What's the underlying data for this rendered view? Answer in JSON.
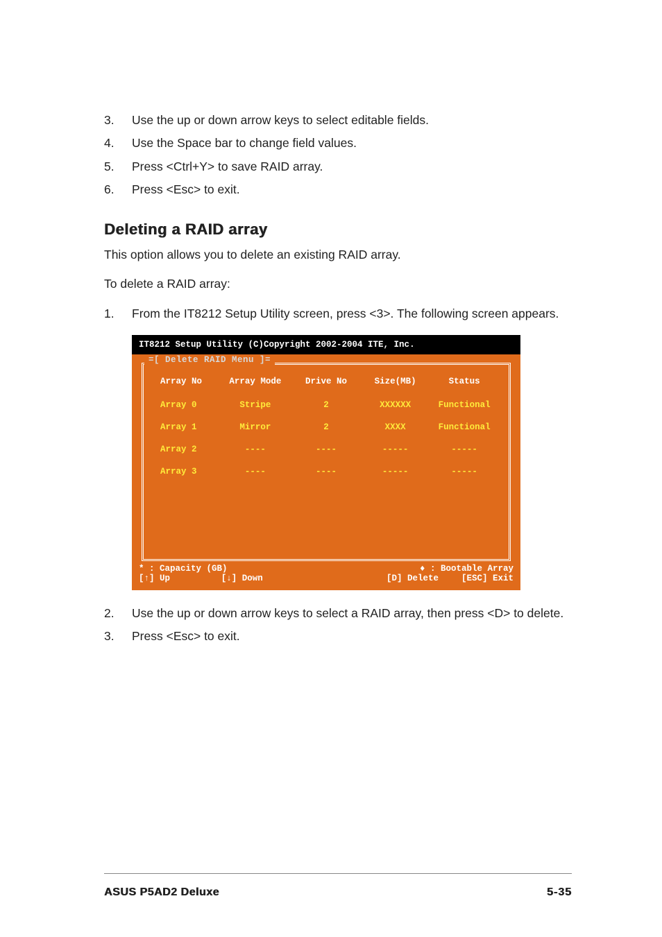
{
  "top_steps": [
    {
      "num": "3.",
      "text": "Use the up or down arrow keys to select editable fields."
    },
    {
      "num": "4.",
      "text": "Use the Space bar to change field values."
    },
    {
      "num": "5.",
      "text": "Press <Ctrl+Y> to save RAID array."
    },
    {
      "num": "6.",
      "text": "Press <Esc> to exit."
    }
  ],
  "section_heading": "Deleting a RAID array",
  "intro_para": "This option allows you to delete an existing RAID array.",
  "lead_para": "To delete a RAID array:",
  "step1": {
    "num": "1.",
    "text": "From the IT8212 Setup Utility screen, press <3>. The following screen appears."
  },
  "screenshot": {
    "title": "IT8212 Setup Utility (C)Copyright 2002-2004 ITE, Inc.",
    "menu_title": "=[ Delete RAID Menu ]=",
    "headers": {
      "c1": "Array No",
      "c2": "Array Mode",
      "c3": "Drive No",
      "c4": "Size(MB)",
      "c5": "Status"
    },
    "rows": [
      {
        "c1": "Array 0",
        "c2": "Stripe",
        "c3": "2",
        "c4": "XXXXXX",
        "c5": "Functional"
      },
      {
        "c1": "Array 1",
        "c2": "Mirror",
        "c3": "2",
        "c4": "XXXX",
        "c5": "Functional"
      },
      {
        "c1": "Array 2",
        "c2": "----",
        "c3": "----",
        "c4": "-----",
        "c5": "-----"
      },
      {
        "c1": "Array 3",
        "c2": "----",
        "c3": "----",
        "c4": "-----",
        "c5": "-----"
      }
    ],
    "footer_line1_left": "* : Capacity (GB)",
    "footer_line1_right": "♦ : Bootable Array",
    "footer_line2_1": "[↑] Up",
    "footer_line2_2": "[↓] Down",
    "footer_line2_3": "[D] Delete",
    "footer_line2_4": "[ESC] Exit"
  },
  "after_steps": [
    {
      "num": "2.",
      "text": "Use the up or down arrow keys to select a RAID array, then press <D> to delete."
    },
    {
      "num": "3.",
      "text": "Press <Esc> to exit."
    }
  ],
  "footer": {
    "product": "ASUS P5AD2 Deluxe",
    "page": "5-35"
  }
}
